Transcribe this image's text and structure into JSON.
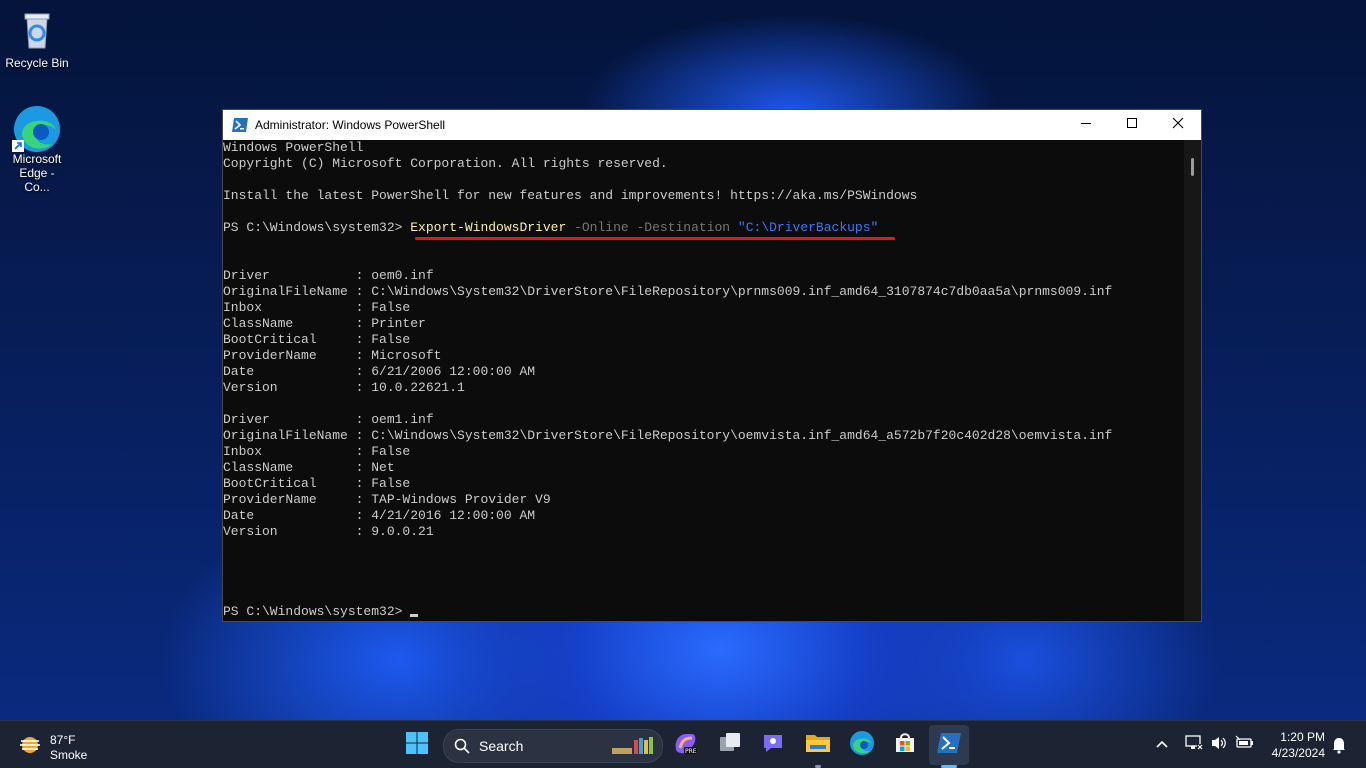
{
  "desktop": {
    "icons": [
      {
        "label": "Recycle Bin",
        "icon": "recycle-bin-icon"
      },
      {
        "label": "Microsoft Edge - Co...",
        "icon": "edge-icon"
      }
    ]
  },
  "window": {
    "title": "Administrator: Windows PowerShell",
    "icon": "powershell-icon",
    "controls": [
      "minimize-icon",
      "maximize-icon",
      "close-icon"
    ]
  },
  "console": {
    "header": [
      "Windows PowerShell",
      "Copyright (C) Microsoft Corporation. All rights reserved.",
      "",
      "Install the latest PowerShell for new features and improvements! https://aka.ms/PSWindows",
      ""
    ],
    "prompt": "PS C:\\Windows\\system32> ",
    "command": {
      "cmdlet": "Export-WindowsDriver",
      "param1": " -Online",
      "param2": " -Destination",
      "value": " \"C:\\DriverBackups\""
    },
    "output": [
      "",
      "",
      "Driver           : oem0.inf",
      "OriginalFileName : C:\\Windows\\System32\\DriverStore\\FileRepository\\prnms009.inf_amd64_3107874c7db0aa5a\\prnms009.inf",
      "Inbox            : False",
      "ClassName        : Printer",
      "BootCritical     : False",
      "ProviderName     : Microsoft",
      "Date             : 6/21/2006 12:00:00 AM",
      "Version          : 10.0.22621.1",
      "",
      "Driver           : oem1.inf",
      "OriginalFileName : C:\\Windows\\System32\\DriverStore\\FileRepository\\oemvista.inf_amd64_a572b7f20c402d28\\oemvista.inf",
      "Inbox            : False",
      "ClassName        : Net",
      "BootCritical     : False",
      "ProviderName     : TAP-Windows Provider V9",
      "Date             : 4/21/2016 12:00:00 AM",
      "Version          : 9.0.0.21",
      "",
      "",
      "",
      ""
    ],
    "final_prompt": "PS C:\\Windows\\system32> "
  },
  "taskbar": {
    "weather": {
      "temp": "87°F",
      "condition": "Smoke"
    },
    "search_label": "Search",
    "apps": [
      "start-icon",
      "search-icon",
      "widgets-icon",
      "copilot-icon",
      "task-view-icon",
      "chat-icon",
      "file-explorer-icon",
      "edge-icon",
      "store-icon",
      "powershell-icon"
    ],
    "clock": {
      "time": "1:20 PM",
      "date": "4/23/2024"
    }
  },
  "colors": {
    "console_bg": "#0c0c0c",
    "console_text": "#cccccc",
    "cmdlet": "#f9f1a5",
    "param": "#767676",
    "string": "#3b78ff",
    "highlight": "#e0191e"
  }
}
